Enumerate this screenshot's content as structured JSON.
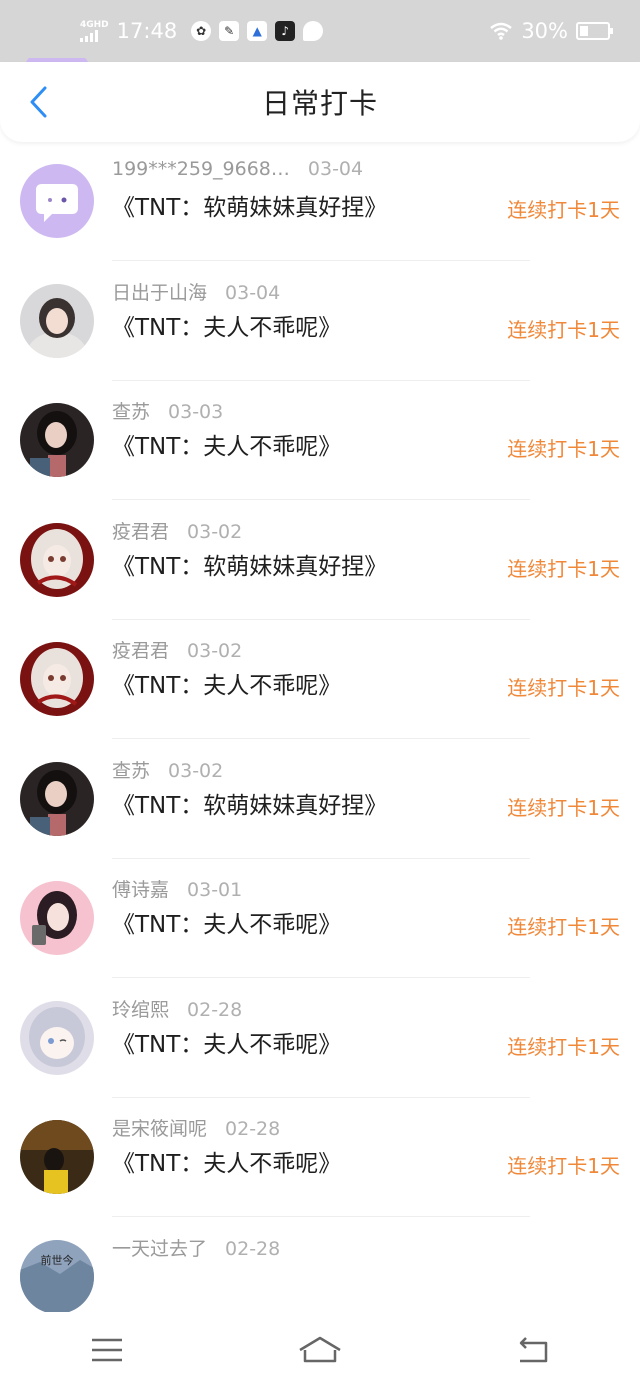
{
  "status_bar": {
    "network": "4GHD",
    "time": "17:48",
    "battery": "30%",
    "battery_level": 0.3
  },
  "header": {
    "title": "日常打卡"
  },
  "entries": [
    {
      "name": "",
      "date": "",
      "book": "",
      "streak": "连续打卡1天",
      "avatar": "cloud-purple"
    },
    {
      "name": "199***259_9668…",
      "date": "03-04",
      "book": "《TNT：软萌妹妹真好捏》",
      "streak": "连续打卡1天",
      "avatar": "chat-bubble"
    },
    {
      "name": "日出于山海",
      "date": "03-04",
      "book": "《TNT：夫人不乖呢》",
      "streak": "连续打卡1天",
      "avatar": "girl-hood"
    },
    {
      "name": "查苏",
      "date": "03-03",
      "book": "《TNT：夫人不乖呢》",
      "streak": "连续打卡1天",
      "avatar": "girl-dark"
    },
    {
      "name": "疫君君",
      "date": "03-02",
      "book": "《TNT：软萌妹妹真好捏》",
      "streak": "连续打卡1天",
      "avatar": "anime-red"
    },
    {
      "name": "疫君君",
      "date": "03-02",
      "book": "《TNT：夫人不乖呢》",
      "streak": "连续打卡1天",
      "avatar": "anime-red"
    },
    {
      "name": "查苏",
      "date": "03-02",
      "book": "《TNT：软萌妹妹真好捏》",
      "streak": "连续打卡1天",
      "avatar": "girl-dark"
    },
    {
      "name": "傅诗嘉",
      "date": "03-01",
      "book": "《TNT：夫人不乖呢》",
      "streak": "连续打卡1天",
      "avatar": "girl-pink"
    },
    {
      "name": "玲绾熙",
      "date": "02-28",
      "book": "《TNT：夫人不乖呢》",
      "streak": "连续打卡1天",
      "avatar": "anime-white"
    },
    {
      "name": "是宋筱闻呢",
      "date": "02-28",
      "book": "《TNT：夫人不乖呢》",
      "streak": "连续打卡1天",
      "avatar": "photo-yellow"
    },
    {
      "name": "一天过去了",
      "date": "02-28",
      "book": "",
      "streak": "",
      "avatar": "calligraphy"
    }
  ],
  "colors": {
    "accent": "#2e8ef5",
    "streak": "#f0883a",
    "status_bg": "#d6d6d6"
  }
}
